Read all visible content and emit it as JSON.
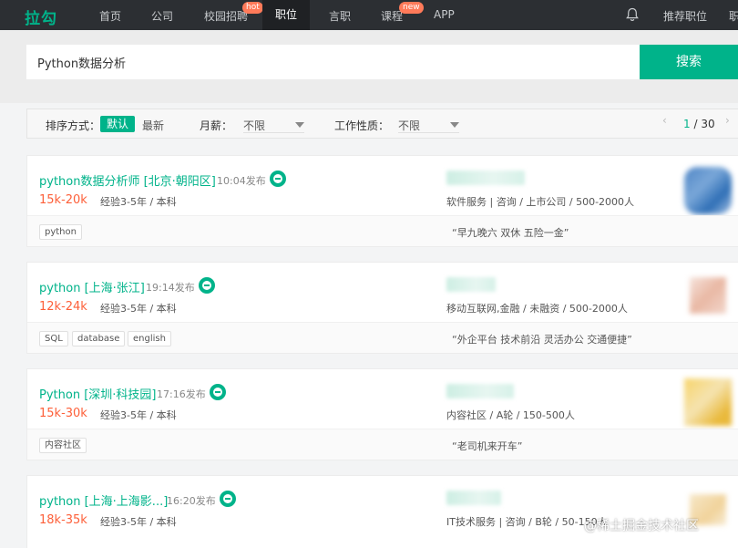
{
  "nav": {
    "logo": "拉勾",
    "items": [
      "首页",
      "公司",
      "校园招聘",
      "职位",
      "言职",
      "课程",
      "APP"
    ],
    "badge_hot": "hot",
    "badge_new": "new",
    "recommend": "推荐职位",
    "more": "职"
  },
  "search": {
    "value": "Python数据分析",
    "button": "搜索"
  },
  "filters": {
    "sort_label": "排序方式：",
    "sort_default": "默认",
    "sort_newest": "最新",
    "salary_label": "月薪：",
    "salary_value": "不限",
    "worktype_label": "工作性质：",
    "worktype_value": "不限",
    "page_prev": "‹",
    "page_current": "1",
    "page_total": " / 30",
    "page_next": "›"
  },
  "jobs": [
    {
      "title": "python数据分析师 [北京·朝阳区]",
      "posted": "10:04发布",
      "salary": "15k-20k",
      "requirements": "经验3-5年 / 本科",
      "company_info": "软件服务 | 咨询 / 上市公司 / 500-2000人",
      "tags": [
        "python"
      ],
      "benefits": "“早九晚六 双休 五险一金”"
    },
    {
      "title": "python [上海·张江]",
      "posted": "19:14发布",
      "salary": "12k-24k",
      "requirements": "经验3-5年 / 本科",
      "company_info": "移动互联网,金融 / 未融资 / 500-2000人",
      "tags": [
        "SQL",
        "database",
        "english"
      ],
      "benefits": "“外企平台 技术前沿 灵活办公 交通便捷”"
    },
    {
      "title": "Python [深圳·科技园]",
      "posted": "17:16发布",
      "salary": "15k-30k",
      "requirements": "经验3-5年 / 本科",
      "company_info": "内容社区 / A轮 / 150-500人",
      "tags": [
        "内容社区"
      ],
      "benefits": "“老司机来开车”"
    },
    {
      "title": "python [上海·上海影...]",
      "posted": "16:20发布",
      "salary": "18k-35k",
      "requirements": "经验3-5年 / 本科",
      "company_info": "IT技术服务 | 咨询 / B轮 / 50-150人",
      "tags": [],
      "benefits": ""
    }
  ],
  "colors": {
    "brand": "#00b38a",
    "salary": "#fd5f39",
    "nav_bg": "#2c2f33"
  },
  "watermark": "@稀土掘金技术社区"
}
